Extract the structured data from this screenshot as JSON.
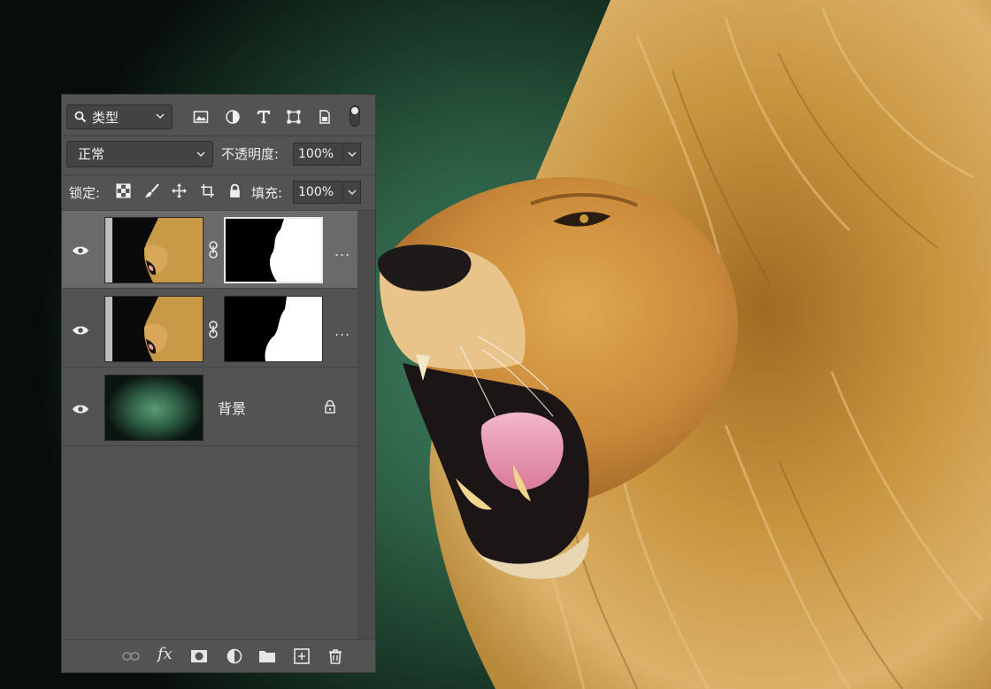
{
  "filter": {
    "label": "类型"
  },
  "blend": {
    "mode": "正常"
  },
  "opacity": {
    "label": "不透明度:",
    "value": "100%"
  },
  "lock": {
    "label": "锁定:"
  },
  "fill": {
    "label": "填充:",
    "value": "100%"
  },
  "layers": [
    {
      "name": "",
      "selected": true,
      "has_mask": true
    },
    {
      "name": "",
      "selected": false,
      "has_mask": true
    },
    {
      "name": "背景",
      "selected": false,
      "locked": true
    }
  ],
  "more_glyph": "...",
  "footer_fx": "fx",
  "colors": {
    "panel_bg": "#535353",
    "selected_row": "#6a6a6a",
    "canvas_center": "#3f7f5f",
    "mane": "#c89a48"
  },
  "icons": [
    "search-icon",
    "image-filter-icon",
    "adjustment-filter-icon",
    "type-filter-icon",
    "shape-filter-icon",
    "smart-object-filter-icon",
    "eye-icon",
    "link-icon",
    "lock-icon",
    "brush-icon",
    "move-icon",
    "artboard-icon",
    "checker-icon",
    "mask-icon",
    "adjustment-icon",
    "folder-icon",
    "new-layer-icon",
    "trash-icon"
  ]
}
